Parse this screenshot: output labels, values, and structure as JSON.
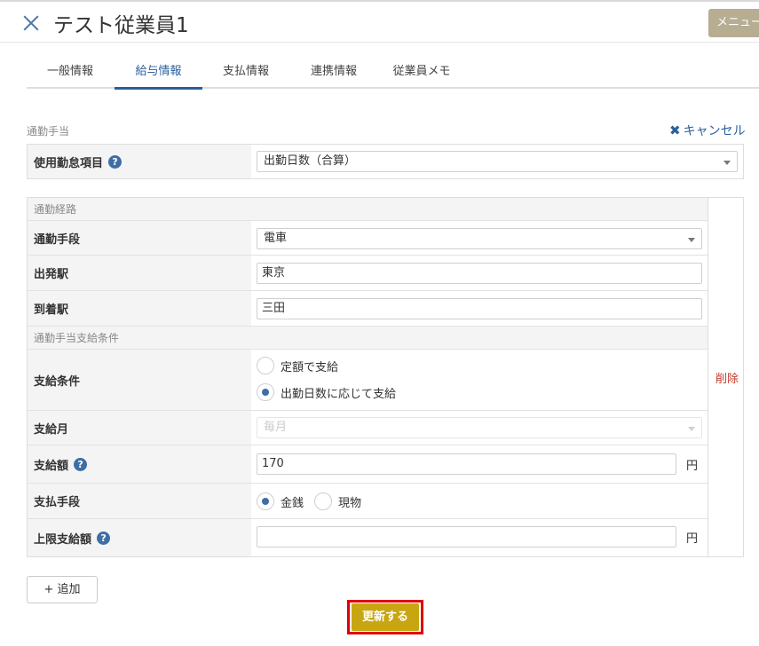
{
  "header": {
    "title": "テスト従業員1",
    "menu_label": "メニュー"
  },
  "tabs": [
    {
      "label": "一般情報",
      "active": false
    },
    {
      "label": "給与情報",
      "active": true
    },
    {
      "label": "支払情報",
      "active": false
    },
    {
      "label": "連携情報",
      "active": false
    },
    {
      "label": "従業員メモ",
      "active": false
    }
  ],
  "commute": {
    "section_label": "通勤手当",
    "cancel_label": "キャンセル",
    "attendance_item": {
      "label": "使用勤怠項目",
      "value": "出勤日数（合算）"
    },
    "route": {
      "section_label": "通勤経路",
      "means": {
        "label": "通勤手段",
        "value": "電車"
      },
      "departure": {
        "label": "出発駅",
        "value": "東京"
      },
      "arrival": {
        "label": "到着駅",
        "value": "三田"
      }
    },
    "payment": {
      "section_label": "通勤手当支給条件",
      "condition": {
        "label": "支給条件",
        "options": [
          {
            "label": "定額で支給",
            "selected": false
          },
          {
            "label": "出勤日数に応じて支給",
            "selected": true
          }
        ]
      },
      "month": {
        "label": "支給月",
        "value": "毎月",
        "disabled": true
      },
      "amount": {
        "label": "支給額",
        "value": "170",
        "unit": "円"
      },
      "method": {
        "label": "支払手段",
        "options": [
          {
            "label": "金銭",
            "selected": true
          },
          {
            "label": "現物",
            "selected": false
          }
        ]
      },
      "max_amount": {
        "label": "上限支給額",
        "value": "",
        "unit": "円"
      }
    },
    "delete_label": "削除",
    "add_label": "+ 追加"
  },
  "footer": {
    "update_label": "更新する"
  },
  "colors": {
    "accent": "#2b5f9e",
    "update_button": "#c7a612",
    "highlight_frame": "#e00000",
    "delete_text": "#c0392b",
    "menu_button": "#b6ad92"
  }
}
